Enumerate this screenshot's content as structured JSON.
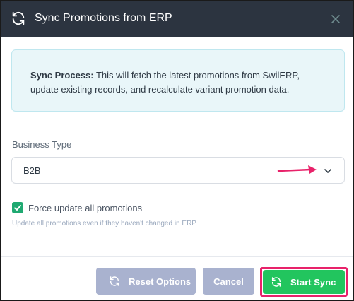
{
  "dialog": {
    "title": "Sync Promotions from ERP",
    "header_icon": "sync-icon",
    "close_icon": "close-icon",
    "header_bg": "#2c3440"
  },
  "info": {
    "lead": "Sync Process:",
    "text": " This will fetch the latest promotions from SwilERP, update existing records, and recalculate variant promotion data.",
    "bg": "#e9f6f9"
  },
  "business_type": {
    "label": "Business Type",
    "selected": "B2B",
    "icon": "chevron-down-icon",
    "annotation_color": "#e8226a"
  },
  "force_update": {
    "checked": true,
    "label": "Force update all promotions",
    "helper": "Update all promotions even if they haven't changed in ERP",
    "color": "#1fa971"
  },
  "footer": {
    "reset_label": "Reset Options",
    "cancel_label": "Cancel",
    "start_label": "Start Sync",
    "start_color": "#22c55e",
    "secondary_color": "#a9b2cf",
    "highlight_color": "#e8226a"
  }
}
